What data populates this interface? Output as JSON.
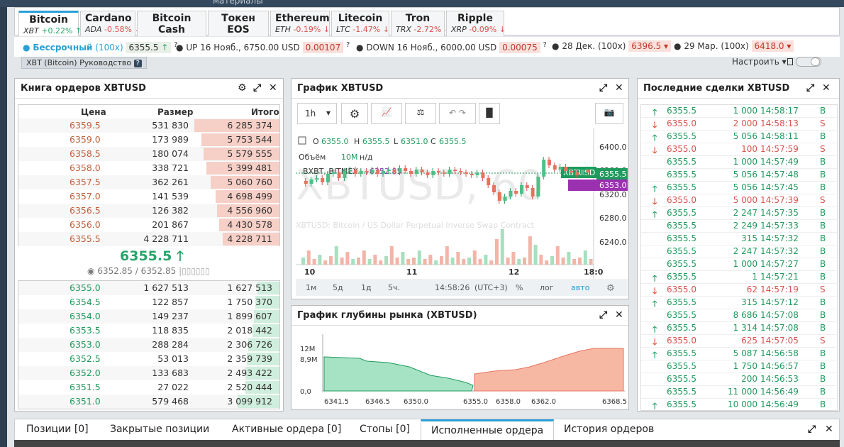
{
  "top_hint": "материалы",
  "coin_tabs": [
    {
      "name": "Bitcoin",
      "ticker": "XBT",
      "change": "+0.22%",
      "dir": "up"
    },
    {
      "name": "Cardano",
      "ticker": "ADA",
      "change": "-0.58%",
      "dir": "down"
    },
    {
      "name": "Bitcoin Cash",
      "ticker": "BCH",
      "change": "-10.16%",
      "dir": "down"
    },
    {
      "name": "Токен EOS",
      "ticker": "EOS",
      "change": "+0.37%",
      "dir": "up"
    },
    {
      "name": "Ethereum",
      "ticker": "ETH",
      "change": "-0.19%",
      "dir": "down"
    },
    {
      "name": "Litecoin",
      "ticker": "LTC",
      "change": "-1.47%",
      "dir": "down"
    },
    {
      "name": "Tron",
      "ticker": "TRX",
      "change": "-2.72%",
      "dir": "down"
    },
    {
      "name": "Ripple",
      "ticker": "XRP",
      "change": "-0.09%",
      "dir": "down"
    }
  ],
  "instruments": {
    "perp_label": "Бессрочный",
    "perp_lev": "(100x)",
    "perp_price": "6355.5",
    "up_label": "UP 16 Нояб., 6750.00 USD",
    "up_price": "0.00107",
    "down_label": "DOWN 16 Нояб., 6000.00 USD",
    "down_price": "0.00075",
    "dec_label": "28 Дек. (100x)",
    "dec_price": "6396.5",
    "mar_label": "29 Мар. (100x)",
    "mar_price": "6418.0"
  },
  "guide": "XBT (Bitcoin) Руководство",
  "settings_label": "Настроить",
  "orderbook": {
    "title": "Книга ордеров XBTUSD",
    "col_price": "Цена",
    "col_size": "Размер",
    "col_total": "Итого",
    "asks": [
      [
        "6359.5",
        "531 830",
        "6 285 374",
        1.0
      ],
      [
        "6359.0",
        "173 989",
        "5 753 544",
        0.92
      ],
      [
        "6358.5",
        "180 074",
        "5 579 555",
        0.89
      ],
      [
        "6358.0",
        "338 721",
        "5 399 481",
        0.86
      ],
      [
        "6357.5",
        "362 261",
        "5 060 760",
        0.81
      ],
      [
        "6357.0",
        "141 539",
        "4 698 499",
        0.75
      ],
      [
        "6356.5",
        "126 382",
        "4 556 960",
        0.73
      ],
      [
        "6356.0",
        "201 867",
        "4 430 578",
        0.71
      ],
      [
        "6355.5",
        "4 228 711",
        "4 228 711",
        0.67
      ]
    ],
    "last_price": "6355.5",
    "mark": "6352.85 / 6352.85",
    "bids": [
      [
        "6355.0",
        "1 627 513",
        "1 627 513",
        0.26
      ],
      [
        "6354.5",
        "122 857",
        "1 750 370",
        0.28
      ],
      [
        "6354.0",
        "149 237",
        "1 899 607",
        0.3
      ],
      [
        "6353.5",
        "118 835",
        "2 018 442",
        0.32
      ],
      [
        "6353.0",
        "288 284",
        "2 306 726",
        0.37
      ],
      [
        "6352.5",
        "53 013",
        "2 359 739",
        0.38
      ],
      [
        "6352.0",
        "133 683",
        "2 493 422",
        0.4
      ],
      [
        "6351.5",
        "27 022",
        "2 520 444",
        0.4
      ],
      [
        "6351.0",
        "579 468",
        "3 099 912",
        0.49
      ]
    ]
  },
  "chart": {
    "title": "График XBTUSD",
    "interval": "1h",
    "ohlc": {
      "o": "6355.0",
      "h": "6355.5",
      "l": "6351.0",
      "c": "6355.5"
    },
    "volume_label": "Объём",
    "volume_val": "10M",
    "volume_nd": "н/д",
    "bxbt": "BXBT, BITMEX",
    "bxbt_val": "6352.85",
    "watermark": "XBTUSD, 60",
    "watermark_sub": "XBTUSD: Bitcoin / US Dollar Perpetual Inverse Swap Contract",
    "y_ticks": [
      "6400.0",
      "6360.0",
      "6320.0",
      "6280.0",
      "6240.0"
    ],
    "price_tag": "6355.5",
    "mark_tag": "6353.0",
    "sym_tag": "XBTUSD",
    "x_ticks": [
      "10",
      "11",
      "12",
      "18:0"
    ],
    "ranges": [
      "1м",
      "5д",
      "1д",
      "5ч."
    ],
    "time": "14:58:26",
    "tz": "(UTC+3)",
    "pct": "%",
    "log": "лог",
    "auto": "авто"
  },
  "depth": {
    "title": "График глубины рынка (XBTUSD)",
    "y_ticks": [
      "12M",
      "8,9M",
      "0,0"
    ],
    "x_ticks": [
      "6341.5",
      "6346.5",
      "6350.0",
      "6355.0",
      "6358.0",
      "6362.0",
      "6368.5"
    ]
  },
  "trades": {
    "title": "Последние сделки XBTUSD",
    "rows": [
      [
        "up",
        "6355.5",
        "1 000",
        "14:58:17",
        "B"
      ],
      [
        "down",
        "6355.0",
        "2 000",
        "14:58:13",
        "S"
      ],
      [
        "up",
        "6355.5",
        "5 056",
        "14:58:11",
        "B"
      ],
      [
        "down",
        "6355.0",
        "100",
        "14:57:59",
        "S"
      ],
      [
        "",
        "6355.5",
        "1 000",
        "14:57:49",
        "B"
      ],
      [
        "",
        "6355.5",
        "5 056",
        "14:57:48",
        "B"
      ],
      [
        "up",
        "6355.5",
        "5 056",
        "14:57:45",
        "B"
      ],
      [
        "down",
        "6355.0",
        "5 000",
        "14:57:39",
        "S"
      ],
      [
        "up",
        "6355.5",
        "2 247",
        "14:57:35",
        "B"
      ],
      [
        "",
        "6355.5",
        "2 249",
        "14:57:33",
        "B"
      ],
      [
        "",
        "6355.5",
        "315",
        "14:57:32",
        "B"
      ],
      [
        "",
        "6355.5",
        "2 247",
        "14:57:32",
        "B"
      ],
      [
        "",
        "6355.5",
        "1 000",
        "14:57:27",
        "B"
      ],
      [
        "up",
        "6355.5",
        "1",
        "14:57:21",
        "B"
      ],
      [
        "down",
        "6355.0",
        "62",
        "14:57:19",
        "S"
      ],
      [
        "up",
        "6355.5",
        "315",
        "14:57:12",
        "B"
      ],
      [
        "",
        "6355.5",
        "8 686",
        "14:57:08",
        "B"
      ],
      [
        "up",
        "6355.5",
        "1 314",
        "14:57:08",
        "B"
      ],
      [
        "down",
        "6355.0",
        "625",
        "14:57:05",
        "S"
      ],
      [
        "up",
        "6355.5",
        "5 087",
        "14:56:58",
        "B"
      ],
      [
        "",
        "6355.5",
        "1 750",
        "14:56:57",
        "B"
      ],
      [
        "",
        "6355.5",
        "200",
        "14:56:53",
        "B"
      ],
      [
        "",
        "6355.5",
        "11 000",
        "14:56:49",
        "B"
      ],
      [
        "up",
        "6355.5",
        "10 000",
        "14:56:49",
        "B"
      ]
    ]
  },
  "bottom_tabs": [
    "Позиции [0]",
    "Закрытые позиции",
    "Активные ордера [0]",
    "Стопы [0]",
    "Исполненные ордера",
    "История ордеров"
  ]
}
